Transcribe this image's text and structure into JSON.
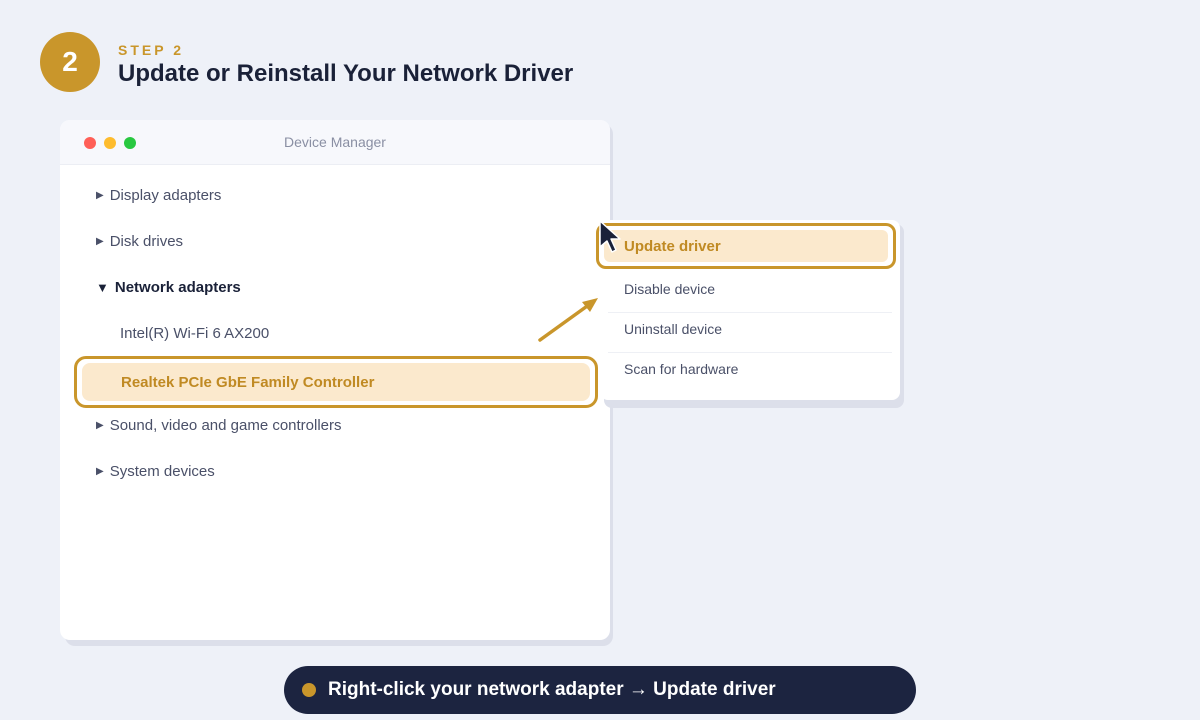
{
  "step": {
    "number": "2",
    "label": "STEP 2",
    "title": "Update or Reinstall Your Network Driver"
  },
  "window": {
    "title": "Device Manager"
  },
  "tree": {
    "items": [
      {
        "label": "Display adapters"
      },
      {
        "label": "Disk drives"
      },
      {
        "label": "Network adapters"
      },
      {
        "label": "Intel(R) Wi-Fi 6 AX200"
      },
      {
        "label": "Realtek PCIe GbE Family Controller"
      },
      {
        "label": "Sound, video and game controllers"
      },
      {
        "label": "System devices"
      }
    ]
  },
  "context_menu": {
    "items": [
      {
        "label": "Update driver"
      },
      {
        "label": "Disable device"
      },
      {
        "label": "Uninstall device"
      },
      {
        "label": "Scan for hardware"
      }
    ]
  },
  "caption": {
    "text": "Right-click your network adapter → Update driver"
  },
  "colors": {
    "accent": "#c9962b",
    "highlight_bg": "#fbe9cd",
    "caption_bg": "#1c2440",
    "page_bg": "#eef1f8"
  },
  "icons": {
    "collapsed": "triangle-right-icon",
    "expanded": "triangle-down-icon",
    "pointer": "mouse-cursor-icon",
    "arrow": "arrow-up-right-icon"
  }
}
